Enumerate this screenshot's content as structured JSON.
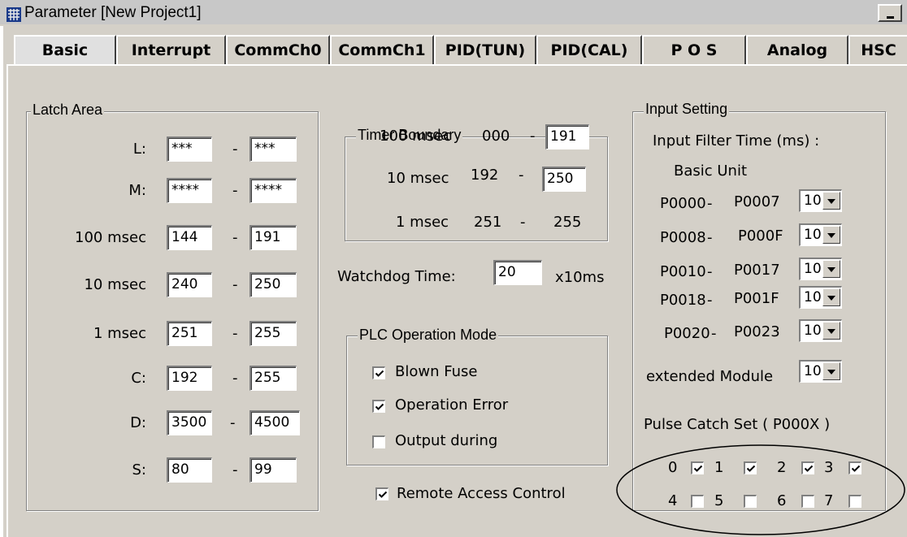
{
  "window": {
    "title": "Parameter [New Project1]",
    "icon": "grid-app-icon",
    "minimize_icon": "minimize-icon"
  },
  "tabs": [
    {
      "label": "Basic",
      "active": true
    },
    {
      "label": "Interrupt"
    },
    {
      "label": "CommCh0"
    },
    {
      "label": "CommCh1"
    },
    {
      "label": "PID(TUN)"
    },
    {
      "label": "PID(CAL)"
    },
    {
      "label": "P O S"
    },
    {
      "label": "Analog"
    },
    {
      "label": "HSC"
    }
  ],
  "latch": {
    "title": "Latch Area",
    "rows": [
      {
        "label": "L:",
        "from": "***",
        "to": "***"
      },
      {
        "label": "M:",
        "from": "****",
        "to": "****"
      },
      {
        "label": "100 msec",
        "from": "144",
        "to": "191"
      },
      {
        "label": "10 msec",
        "from": "240",
        "to": "250"
      },
      {
        "label": "1 msec",
        "from": "251",
        "to": "255"
      },
      {
        "label": "C:",
        "from": "192",
        "to": "255"
      },
      {
        "label": "D:",
        "from": "3500",
        "to": "4500"
      },
      {
        "label": "S:",
        "from": "80",
        "to": "99"
      }
    ],
    "dash": "-"
  },
  "timer": {
    "title": "Timer Boundary",
    "r1": {
      "label": "100 msec",
      "from": "000",
      "to": "191"
    },
    "r2": {
      "label": "10 msec",
      "from": "192",
      "to": "250"
    },
    "r3": {
      "label": "1 msec",
      "from": "251",
      "to": "255"
    },
    "dash": "-"
  },
  "watchdog": {
    "label": "Watchdog Time:",
    "value": "20",
    "unit": "x10ms"
  },
  "plc_mode": {
    "title": "PLC Operation Mode",
    "items": [
      {
        "label": "Blown Fuse",
        "checked": true
      },
      {
        "label": "Operation Error",
        "checked": true
      },
      {
        "label": "Output during",
        "checked": false
      }
    ]
  },
  "remote": {
    "label": "Remote Access Control",
    "checked": true
  },
  "input": {
    "title": "Input Setting",
    "filter_label": "Input Filter Time (ms) :",
    "basic_unit": "Basic Unit",
    "rows": [
      {
        "from": "P0000",
        "to": "P0007",
        "value": "10"
      },
      {
        "from": "P0008",
        "to": "P000F",
        "value": "10"
      },
      {
        "from": "P0010",
        "to": "P0017",
        "value": "10"
      },
      {
        "from": "P0018",
        "to": "P001F",
        "value": "10"
      },
      {
        "from": "P0020",
        "to": "P0023",
        "value": "10"
      }
    ],
    "dash": "-",
    "extended_label": "extended Module",
    "extended_value": "10",
    "pulse_title": "Pulse Catch Set ( P000X )",
    "pulse": [
      {
        "n": "0",
        "checked": true
      },
      {
        "n": "1",
        "checked": true
      },
      {
        "n": "2",
        "checked": true
      },
      {
        "n": "3",
        "checked": true
      },
      {
        "n": "4",
        "checked": false
      },
      {
        "n": "5",
        "checked": false
      },
      {
        "n": "6",
        "checked": false
      },
      {
        "n": "7",
        "checked": false
      }
    ]
  }
}
